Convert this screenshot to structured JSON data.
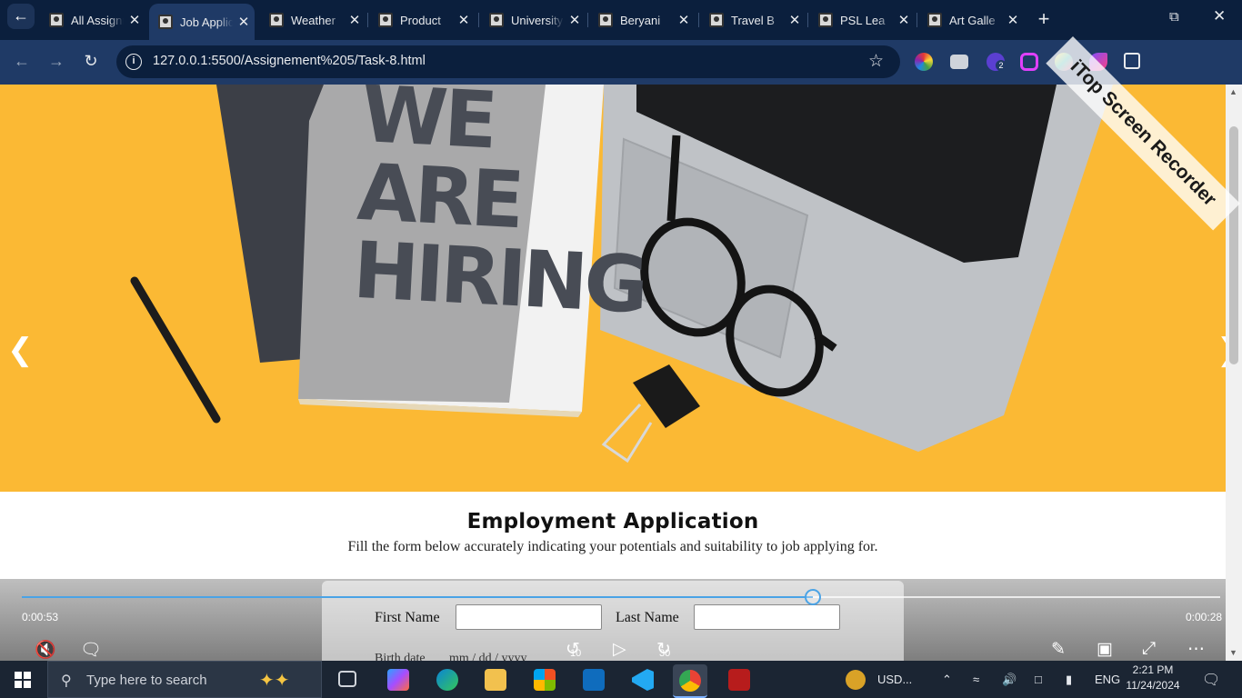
{
  "browser": {
    "tabs": [
      {
        "title": "All Assignments",
        "active": false
      },
      {
        "title": "Job Application",
        "active": true
      },
      {
        "title": "Weather",
        "active": false
      },
      {
        "title": "Product",
        "active": false
      },
      {
        "title": "University",
        "active": false
      },
      {
        "title": "Beryani",
        "active": false
      },
      {
        "title": "Travel B",
        "active": false
      },
      {
        "title": "PSL Lea",
        "active": false
      },
      {
        "title": "Art Galle",
        "active": false
      }
    ],
    "url": "127.0.0.1:5500/Assignement%205/Task-8.html",
    "extension_badge": "2"
  },
  "page": {
    "hero_text_lines": [
      "WE",
      "ARE",
      "HIRING"
    ],
    "title": "Employment Application",
    "subtitle": "Fill the form below accurately indicating your potentials and suitability to job applying for.",
    "form": {
      "first_name_label": "First Name",
      "last_name_label": "Last Name",
      "first_name_value": "",
      "last_name_value": "",
      "birth_date_label": "Birth date",
      "birth_date_placeholder": "mm / dd / yyyy"
    }
  },
  "player": {
    "elapsed": "0:00:53",
    "remaining": "0:00:28",
    "progress": 0.66,
    "rewind_label": "10",
    "forward_label": "30"
  },
  "taskbar": {
    "search_placeholder": "Type here to search",
    "currency_widget": "USD...",
    "language": "ENG",
    "time": "2:21 PM",
    "date": "11/24/2024"
  },
  "watermark": "iTop Screen Recorder",
  "colors": {
    "tab_strip": "#0b1f3d",
    "toolbar": "#1f3a66",
    "hero_background": "#fbb934",
    "progress_accent": "#4aa3e6"
  }
}
